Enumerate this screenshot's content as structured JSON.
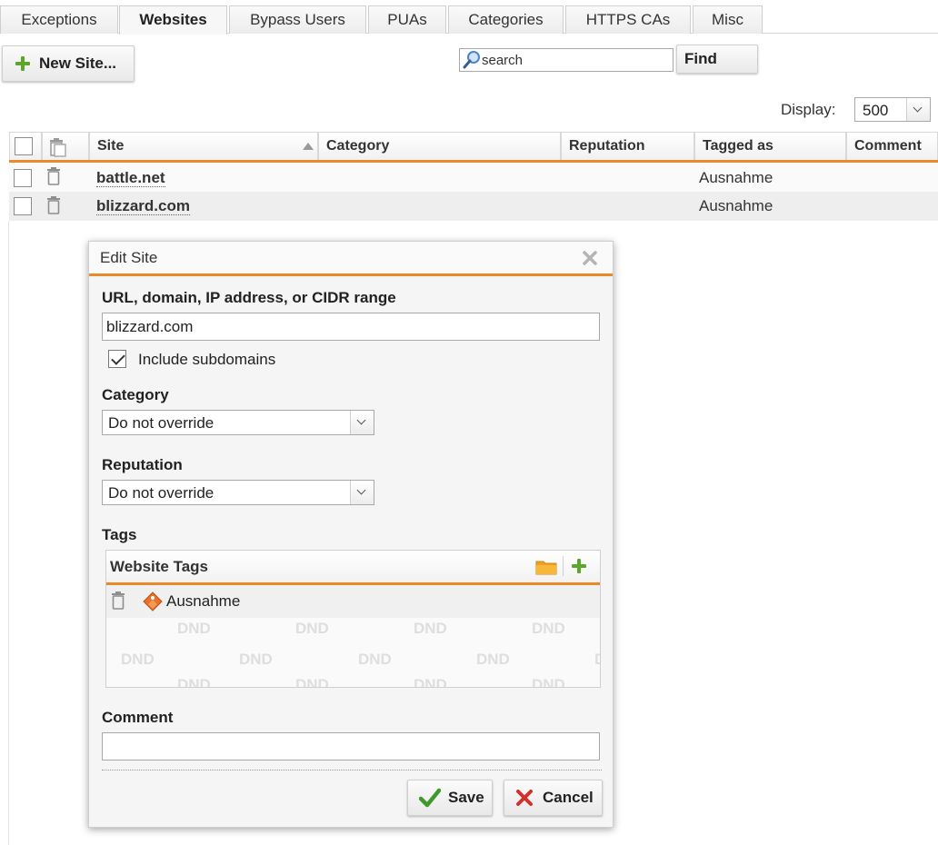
{
  "tabs": [
    {
      "label": "Exceptions",
      "active": false
    },
    {
      "label": "Websites",
      "active": true
    },
    {
      "label": "Bypass Users",
      "active": false
    },
    {
      "label": "PUAs",
      "active": false
    },
    {
      "label": "Categories",
      "active": false
    },
    {
      "label": "HTTPS CAs",
      "active": false
    },
    {
      "label": "Misc",
      "active": false
    }
  ],
  "toolbar": {
    "new_site_label": "New Site...",
    "search_placeholder": "search",
    "find_label": "Find",
    "display_label": "Display:",
    "display_value": "500"
  },
  "table": {
    "headers": {
      "site": "Site",
      "category": "Category",
      "reputation": "Reputation",
      "tagged_as": "Tagged as",
      "comment": "Comment"
    },
    "rows": [
      {
        "site": "battle.net",
        "category": "",
        "reputation": "",
        "tagged_as": "Ausnahme",
        "comment": ""
      },
      {
        "site": "blizzard.com",
        "category": "",
        "reputation": "",
        "tagged_as": "Ausnahme",
        "comment": ""
      }
    ]
  },
  "dialog": {
    "title": "Edit Site",
    "url_label": "URL, domain, IP address, or CIDR range",
    "url_value": "blizzard.com",
    "include_subdomains_label": "Include subdomains",
    "include_subdomains_checked": true,
    "category_label": "Category",
    "category_value": "Do not override",
    "reputation_label": "Reputation",
    "reputation_value": "Do not override",
    "tags_label": "Tags",
    "tags_panel_title": "Website Tags",
    "tags": [
      "Ausnahme"
    ],
    "dnd_text": "DND",
    "comment_label": "Comment",
    "comment_value": "",
    "save_label": "Save",
    "cancel_label": "Cancel"
  },
  "colors": {
    "accent_orange": "#e8892a",
    "plus_green": "#5aa72a",
    "save_check_green": "#3d9a2b",
    "cancel_x_red": "#d0312d",
    "folder_orange": "#f0a020"
  }
}
